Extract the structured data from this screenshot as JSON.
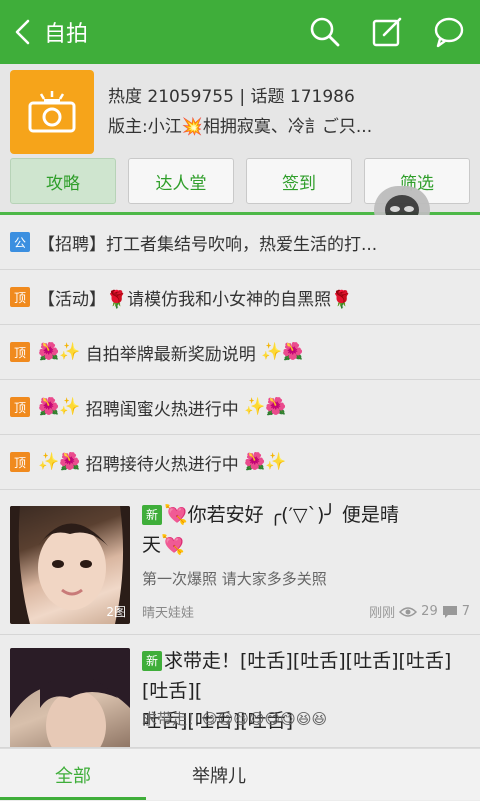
{
  "header": {
    "title": "自拍",
    "heat_label": "热度",
    "heat_value": "21059755",
    "topic_label": "话题",
    "topic_value": "171986",
    "moderator_prefix": "版主:小江",
    "moderator_rest": "相拥寂寞、冷訁ご只..."
  },
  "tabs": [
    "攻略",
    "达人堂",
    "签到",
    "筛选"
  ],
  "notices": [
    {
      "badge": "公",
      "type": "gong",
      "pre": "",
      "text": "【招聘】打工者集结号吹响，热爱生活的打...",
      "post": ""
    },
    {
      "badge": "顶",
      "type": "ding",
      "pre": "",
      "text": "【活动】🌹请模仿我和小女神的自黑照🌹",
      "post": ""
    },
    {
      "badge": "顶",
      "type": "ding",
      "pre": "🌺✨",
      "text": "自拍举牌最新奖励说明",
      "post": "✨🌺"
    },
    {
      "badge": "顶",
      "type": "ding",
      "pre": "🌺✨",
      "text": "招聘闺蜜火热进行中",
      "post": "✨🌺"
    },
    {
      "badge": "顶",
      "type": "ding",
      "pre": "✨🌺",
      "text": "招聘接待火热进行中",
      "post": "🌺✨"
    }
  ],
  "posts": [
    {
      "new_label": "新",
      "title_line1": "你若安好 ╭(′▽`)╯ 便是晴",
      "title_line2": "天",
      "subtitle": "第一次爆照  请大家多多关照",
      "author": "晴天娃娃",
      "time": "刚刚",
      "views": "29",
      "comments": "7",
      "img_count": "2图"
    },
    {
      "new_label": "新",
      "title_line1": "求带走！[吐舌][吐舌][吐舌][吐舌][吐舌][",
      "title_line2": "吐舌][吐舌][吐舌]",
      "subtitle": "求带走！😋😋😋😋😋😋😆😆"
    }
  ],
  "bottom_tabs": [
    "全部",
    "举牌儿"
  ],
  "colors": {
    "primary_green": "#3fae3a",
    "camera_orange": "#f6a41a",
    "notice_blue": "#3b8fe0",
    "notice_orange": "#f08a1e"
  },
  "icons": [
    "back-arrow-icon",
    "search-icon",
    "edit-icon",
    "message-icon",
    "camera-icon",
    "eye-icon",
    "comment-icon"
  ]
}
